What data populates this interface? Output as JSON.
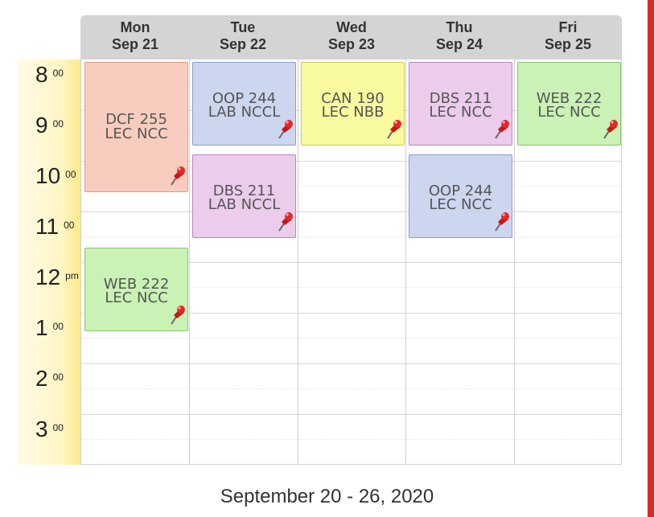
{
  "days": [
    {
      "name": "Mon",
      "date": "Sep 21"
    },
    {
      "name": "Tue",
      "date": "Sep 22"
    },
    {
      "name": "Wed",
      "date": "Sep 23"
    },
    {
      "name": "Thu",
      "date": "Sep 24"
    },
    {
      "name": "Fri",
      "date": "Sep 25"
    }
  ],
  "hours": [
    {
      "num": "8",
      "sup": "00"
    },
    {
      "num": "9",
      "sup": "00"
    },
    {
      "num": "10",
      "sup": "00"
    },
    {
      "num": "11",
      "sup": "00"
    },
    {
      "num": "12",
      "sup": "pm"
    },
    {
      "num": "1",
      "sup": "00"
    },
    {
      "num": "2",
      "sup": "00"
    },
    {
      "num": "3",
      "sup": "00"
    }
  ],
  "events": [
    {
      "line1": "DCF 255",
      "line2": "LEC NCC",
      "day": "Mon",
      "start": "8:00",
      "end": "10:30",
      "color": "#f8cdbf",
      "border": "#e39a85"
    },
    {
      "line1": "WEB 222",
      "line2": "LEC NCC",
      "day": "Mon",
      "start": "11:30",
      "end": "1:10",
      "color": "#c9f2b4",
      "border": "#86c56f"
    },
    {
      "line1": "OOP 244",
      "line2": "LAB NCCL",
      "day": "Tue",
      "start": "8:00",
      "end": "9:40",
      "color": "#cdd6ef",
      "border": "#8b9bd0"
    },
    {
      "line1": "DBS 211",
      "line2": "LAB NCCL",
      "day": "Tue",
      "start": "9:50",
      "end": "11:30",
      "color": "#ebcdeb",
      "border": "#b986bd"
    },
    {
      "line1": "CAN 190",
      "line2": "LEC NBB",
      "day": "Wed",
      "start": "8:00",
      "end": "9:40",
      "color": "#fafaa0",
      "border": "#caca5c"
    },
    {
      "line1": "DBS 211",
      "line2": "LEC NCC",
      "day": "Thu",
      "start": "8:00",
      "end": "9:40",
      "color": "#ebcdeb",
      "border": "#b986bd"
    },
    {
      "line1": "OOP 244",
      "line2": "LEC NCC",
      "day": "Thu",
      "start": "9:50",
      "end": "11:30",
      "color": "#cdd6ef",
      "border": "#8b9bd0"
    },
    {
      "line1": "WEB 222",
      "line2": "LEC NCC",
      "day": "Fri",
      "start": "8:00",
      "end": "9:40",
      "color": "#c9f2b4",
      "border": "#86c56f"
    }
  ],
  "pin_icon": "pushpin-icon",
  "colors": {
    "accent_bar": "#d92d2d",
    "header_bg": "#d4d4d4",
    "time_col": "#fff6c4"
  },
  "footer": {
    "date_range": "September 20 - 26, 2020"
  }
}
